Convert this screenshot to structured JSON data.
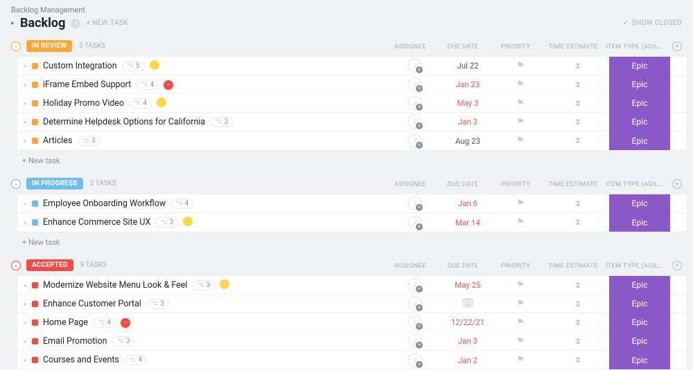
{
  "breadcrumb": "Backlog Management",
  "page_title": "Backlog",
  "new_task_top": "+ NEW TASK",
  "show_closed": "SHOW CLOSED",
  "columns": {
    "assignee": "ASSIGNEE",
    "due": "DUE DATE",
    "priority": "PRIORITY",
    "time": "TIME ESTIMATE",
    "item": "ITEM TYPE (AGIL..."
  },
  "new_task_row": "+ New task",
  "groups": [
    {
      "status": "IN REVIEW",
      "color": "orange",
      "count": "5 TASKS",
      "tasks": [
        {
          "name": "Custom Integration",
          "sub": "5",
          "tag": "yellow",
          "due": "Jul 22",
          "overdue": false,
          "item": "Epic"
        },
        {
          "name": "iFrame Embed Support",
          "sub": "4",
          "tag": "red",
          "due": "Jan 23",
          "overdue": true,
          "item": "Epic"
        },
        {
          "name": "Holiday Promo Video",
          "sub": "4",
          "tag": "yellow",
          "due": "May 3",
          "overdue": true,
          "item": "Epic"
        },
        {
          "name": "Determine Helpdesk Options for California",
          "sub": "3",
          "tag": "",
          "due": "Jan 3",
          "overdue": true,
          "item": "Epic"
        },
        {
          "name": "Articles",
          "sub": "3",
          "tag": "",
          "due": "Aug 23",
          "overdue": false,
          "item": "Epic"
        }
      ]
    },
    {
      "status": "IN PROGRESS",
      "color": "blue",
      "count": "2 TASKS",
      "tasks": [
        {
          "name": "Employee Onboarding Workflow",
          "sub": "4",
          "tag": "",
          "due": "Jan 6",
          "overdue": true,
          "item": "Epic"
        },
        {
          "name": "Enhance Commerce Site UX",
          "sub": "3",
          "tag": "yellow",
          "due": "Mar 14",
          "overdue": true,
          "item": "Epic"
        }
      ]
    },
    {
      "status": "ACCEPTED",
      "color": "red",
      "count": "9 TASKS",
      "tasks": [
        {
          "name": "Modernize Website Menu Look & Feel",
          "sub": "3",
          "tag": "yellow",
          "due": "May 25",
          "overdue": true,
          "item": "Epic"
        },
        {
          "name": "Enhance Customer Portal",
          "sub": "3",
          "tag": "",
          "due": "calendar",
          "overdue": false,
          "item": "Epic"
        },
        {
          "name": "Home Page",
          "sub": "4",
          "tag": "red",
          "due": "12/22/21",
          "overdue": true,
          "item": "Epic"
        },
        {
          "name": "Email Promotion",
          "sub": "3",
          "tag": "",
          "due": "Jan 3",
          "overdue": true,
          "item": "Epic"
        },
        {
          "name": "Courses and Events",
          "sub": "4",
          "tag": "",
          "due": "Jan 2",
          "overdue": true,
          "item": "Epic"
        }
      ]
    }
  ]
}
